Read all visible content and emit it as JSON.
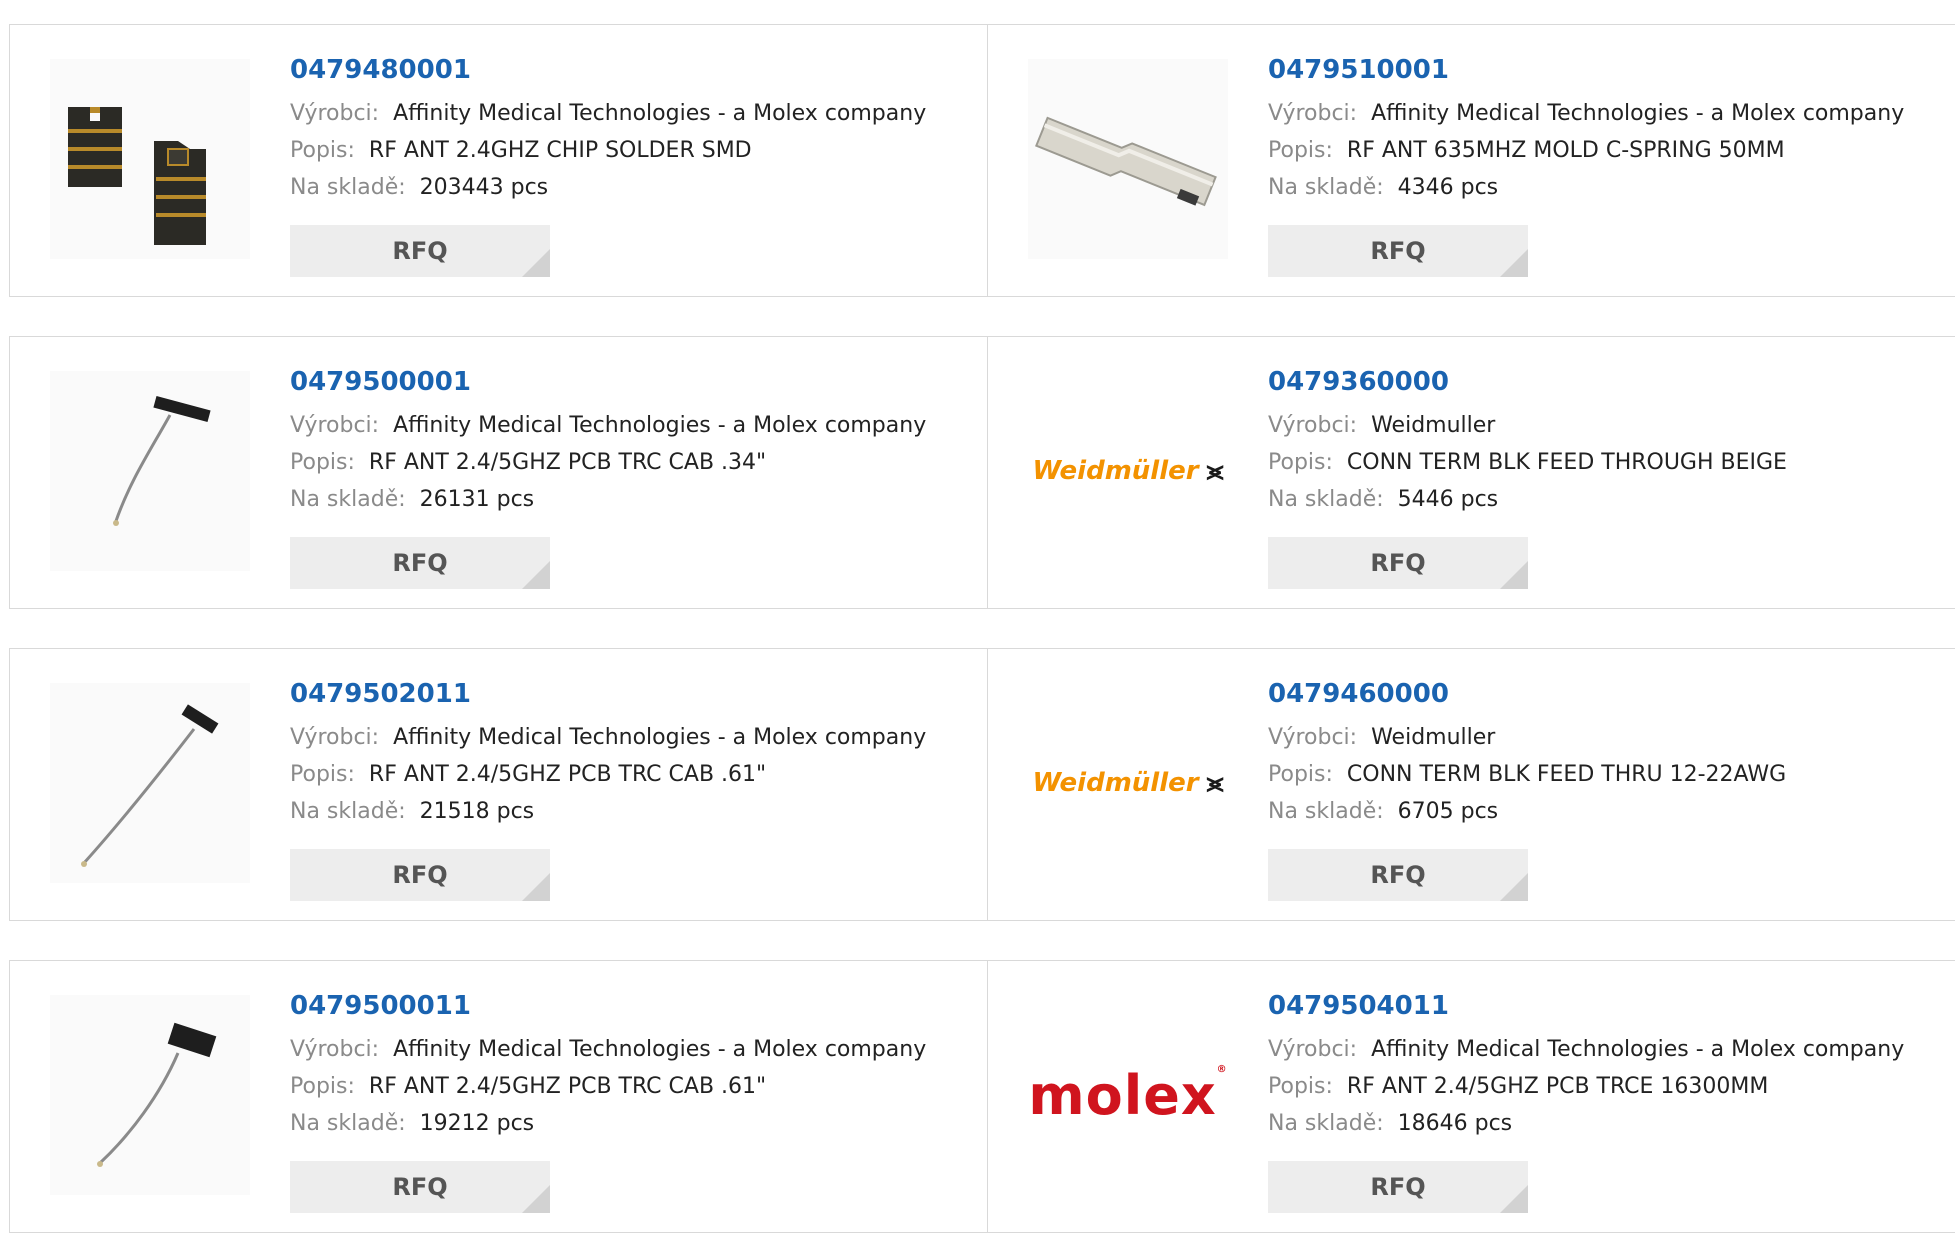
{
  "labels": {
    "manufacturer": "Výrobci:",
    "description": "Popis:",
    "stock": "Na skladě:",
    "rfq": "RFQ"
  },
  "brand_logos": {
    "weidmuller": "Weidmüller",
    "weidmuller_mark": "⪤",
    "molex": "molex"
  },
  "colors": {
    "part_link": "#1a63b0",
    "label_gray": "#8a8a8a",
    "rfq_bg": "#ededed",
    "weidmuller_orange": "#f39200",
    "molex_red": "#d0141e"
  },
  "products": [
    {
      "part": "0479480001",
      "manufacturer": "Affinity Medical Technologies - a Molex company",
      "description": "RF ANT 2.4GHZ CHIP SOLDER SMD",
      "stock": "203443 pcs",
      "image": "chip-antenna-image"
    },
    {
      "part": "0479510001",
      "manufacturer": "Affinity Medical Technologies - a Molex company",
      "description": "RF ANT 635MHZ MOLD C-SPRING 50MM",
      "stock": "4346 pcs",
      "image": "spring-antenna-image"
    },
    {
      "part": "0479500001",
      "manufacturer": "Affinity Medical Technologies - a Molex company",
      "description": "RF ANT 2.4/5GHZ PCB TRC CAB .34\"",
      "stock": "26131 pcs",
      "image": "pcb-cable-antenna-image"
    },
    {
      "part": "0479360000",
      "manufacturer": "Weidmuller",
      "description": "CONN TERM BLK FEED THROUGH BEIGE",
      "stock": "5446 pcs",
      "image": "weidmuller-logo"
    },
    {
      "part": "0479502011",
      "manufacturer": "Affinity Medical Technologies - a Molex company",
      "description": "RF ANT 2.4/5GHZ PCB TRC CAB .61\"",
      "stock": "21518 pcs",
      "image": "pcb-cable-antenna-image"
    },
    {
      "part": "0479460000",
      "manufacturer": "Weidmuller",
      "description": "CONN TERM BLK FEED THRU 12-22AWG",
      "stock": "6705 pcs",
      "image": "weidmuller-logo"
    },
    {
      "part": "0479500011",
      "manufacturer": "Affinity Medical Technologies - a Molex company",
      "description": "RF ANT 2.4/5GHZ PCB TRC CAB .61\"",
      "stock": "19212 pcs",
      "image": "pcb-cable-antenna-image"
    },
    {
      "part": "0479504011",
      "manufacturer": "Affinity Medical Technologies - a Molex company",
      "description": "RF ANT 2.4/5GHZ PCB TRCE 16300MM",
      "stock": "18646 pcs",
      "image": "molex-logo"
    }
  ]
}
